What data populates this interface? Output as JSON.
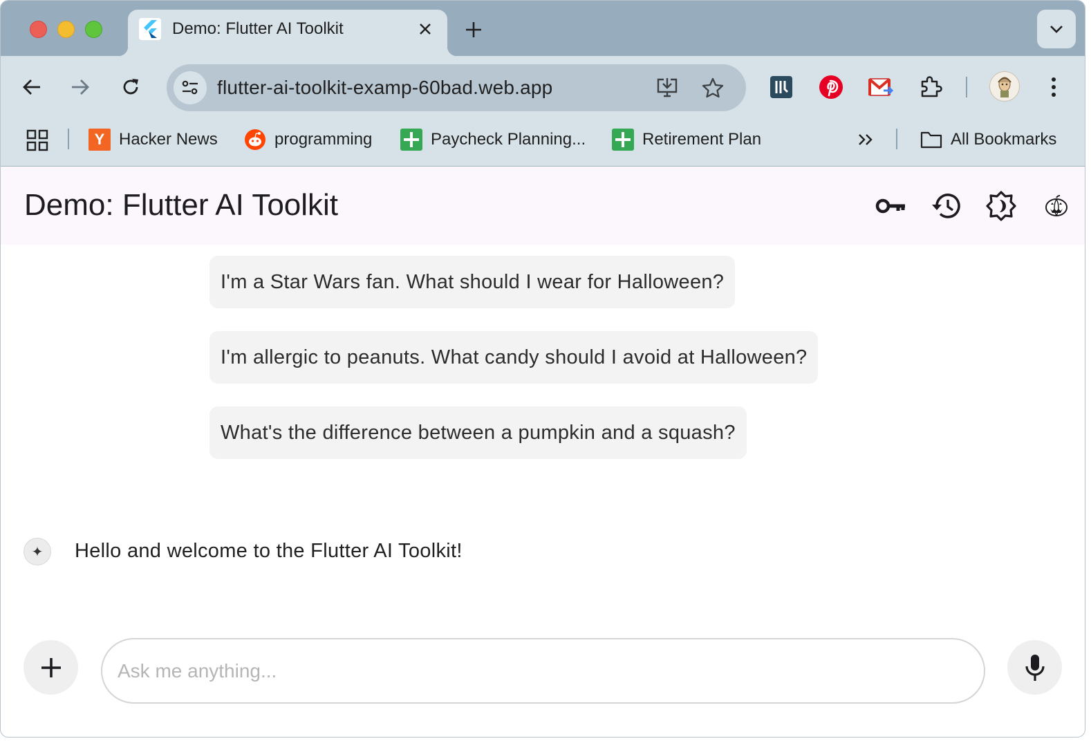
{
  "browser": {
    "tab": {
      "title": "Demo: Flutter AI Toolkit"
    },
    "omnibox": {
      "url": "flutter-ai-toolkit-examp-60bad.web.app"
    },
    "bookmarks": [
      {
        "label": "Hacker News",
        "icon": "hacker-news-icon"
      },
      {
        "label": "programming",
        "icon": "reddit-icon"
      },
      {
        "label": "Paycheck Planning...",
        "icon": "sheets-icon"
      },
      {
        "label": "Retirement Plan",
        "icon": "sheets-icon"
      }
    ],
    "all_bookmarks_label": "All Bookmarks",
    "extensions": [
      "bookmark-extension-icon",
      "pinterest-icon",
      "gmail-icon",
      "puzzle-icon"
    ]
  },
  "app": {
    "title": "Demo: Flutter AI Toolkit",
    "actions": [
      "key-icon",
      "history-icon",
      "brightness-icon",
      "pumpkin-icon"
    ],
    "suggestions": [
      "I'm a Star Wars fan. What should I wear for Halloween?",
      "I'm allergic to peanuts. What candy should I avoid at Halloween?",
      "What's the difference between a pumpkin and a squash?"
    ],
    "welcome_message": "Hello and welcome to the Flutter AI Toolkit!",
    "input": {
      "placeholder": "Ask me anything...",
      "value": ""
    }
  },
  "colors": {
    "tab_strip": "#97adbd",
    "toolbar": "#d6e1e8",
    "appbar": "#fcf7fc",
    "suggestion_bg": "#f3f3f3"
  }
}
